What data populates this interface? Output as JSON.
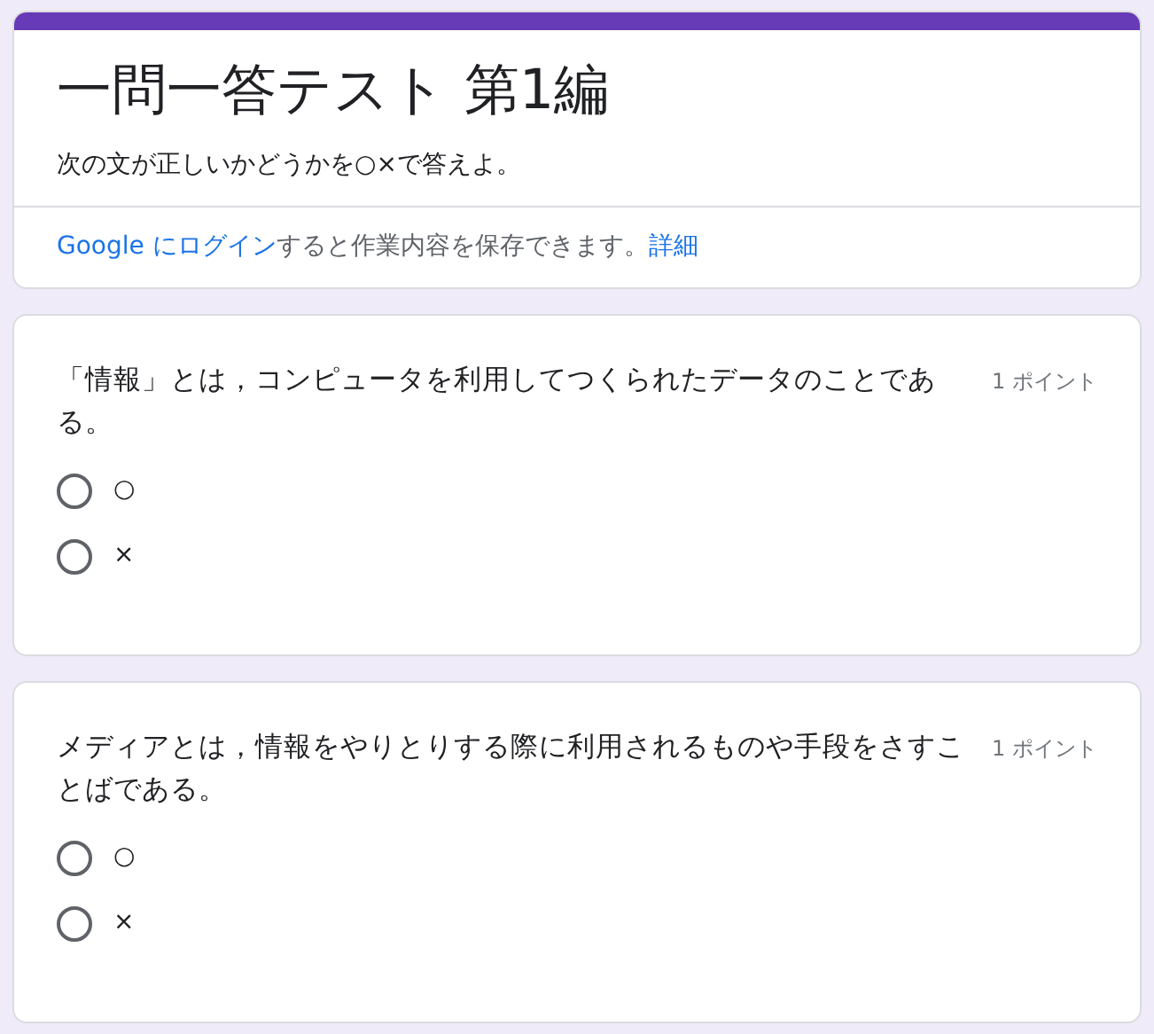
{
  "header": {
    "title": "一問一答テスト 第1編",
    "description": "次の文が正しいかどうかを○×で答えよ。",
    "login_link": "Google にログイン",
    "notice_text": "すると作業内容を保存できます。",
    "details_link": "詳細"
  },
  "questions": [
    {
      "text": "「情報」とは，コンピュータを利用してつくられたデータのことである。",
      "points": "1 ポイント",
      "options": [
        {
          "label": "○",
          "selected": false
        },
        {
          "label": "×",
          "selected": false
        }
      ]
    },
    {
      "text": "メディアとは，情報をやりとりする際に利用されるものや手段をさすことばである。",
      "points": "1 ポイント",
      "options": [
        {
          "label": "○",
          "selected": false
        },
        {
          "label": "×",
          "selected": false
        }
      ]
    }
  ]
}
